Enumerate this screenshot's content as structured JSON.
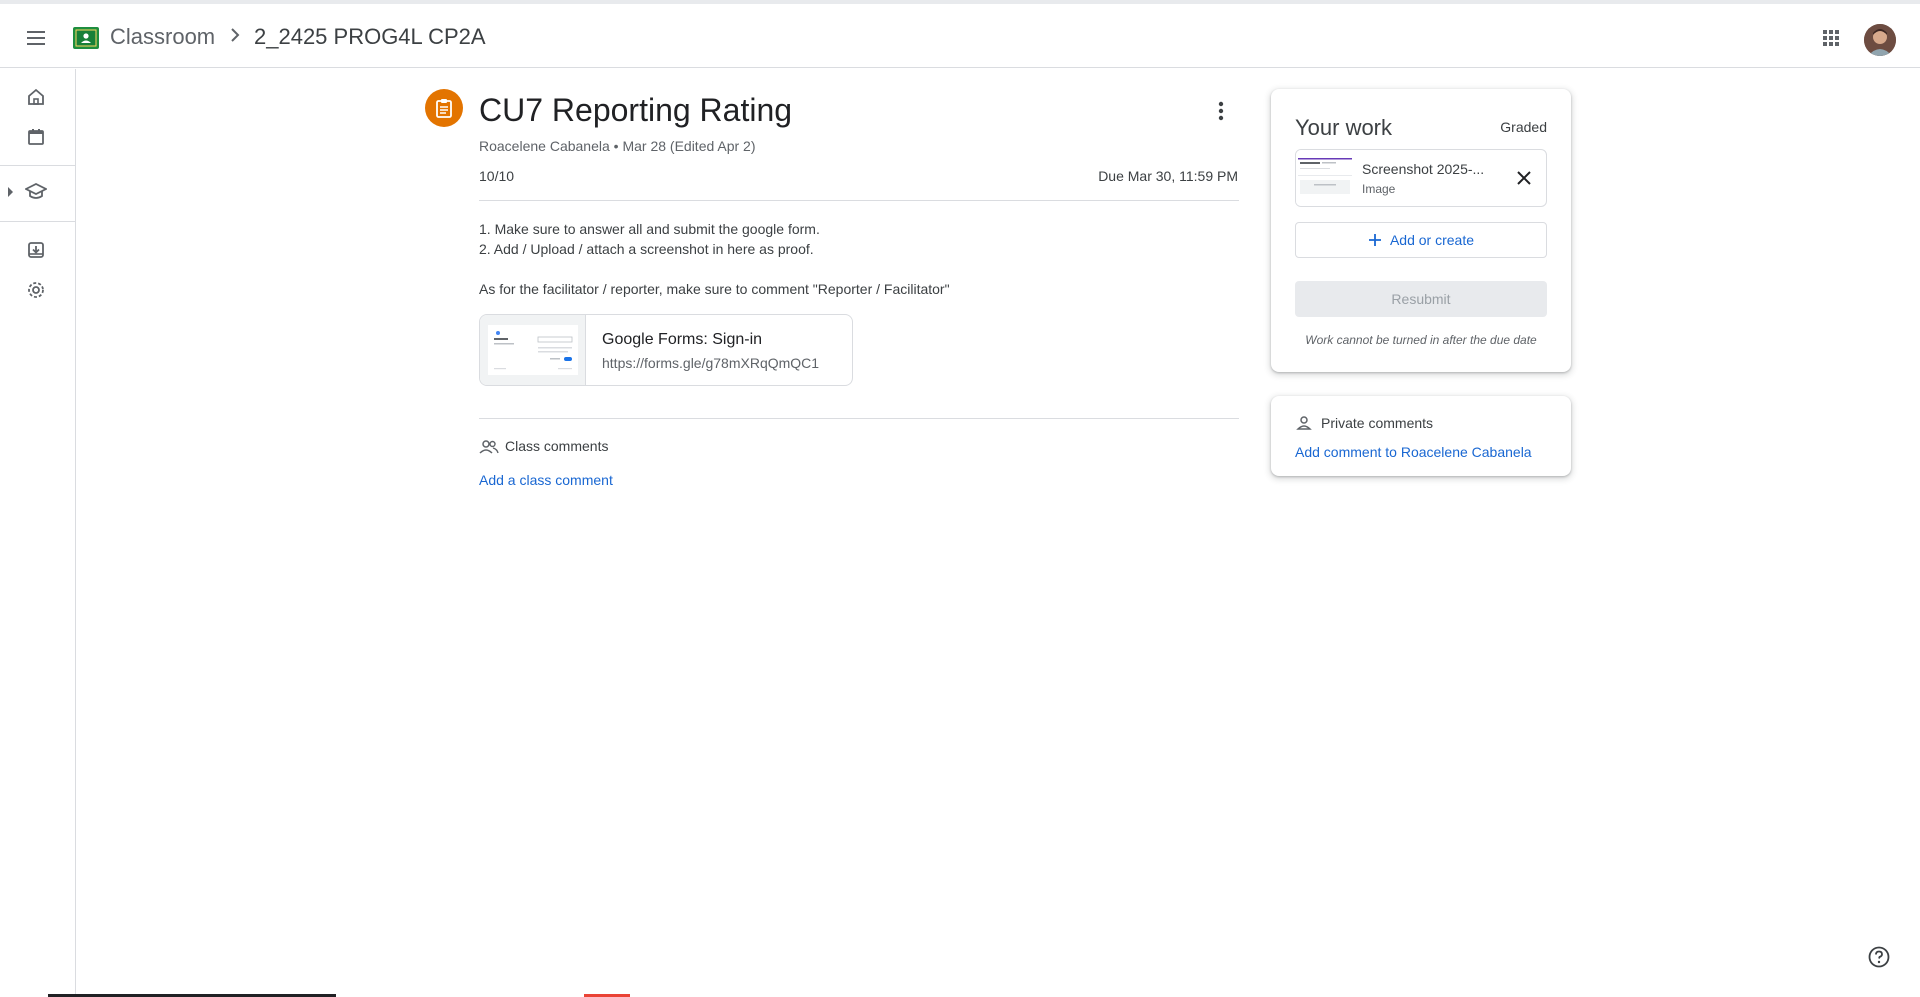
{
  "header": {
    "app_name": "Classroom",
    "course_name": "2_2425 PROG4L CP2A"
  },
  "assignment": {
    "title": "CU7 Reporting Rating",
    "meta": "Roacelene Cabanela • Mar 28 (Edited Apr 2)",
    "points": "10/10",
    "due": "Due Mar 30, 11:59 PM",
    "instructions": [
      "1. Make sure to answer all and submit the google form.",
      "2. Add / Upload / attach a screenshot in here as proof.",
      "",
      "As for the facilitator / reporter, make sure to comment \"Reporter / Facilitator\""
    ],
    "attachment": {
      "title": "Google Forms: Sign-in",
      "url": "https://forms.gle/g78mXRqQmQC1"
    }
  },
  "class_comments": {
    "label": "Class comments",
    "add_label": "Add a class comment"
  },
  "your_work": {
    "title": "Your work",
    "status": "Graded",
    "file": {
      "name": "Screenshot 2025-...",
      "type": "Image"
    },
    "add_label": "Add or create",
    "resubmit_label": "Resubmit",
    "note": "Work cannot be turned in after the due date"
  },
  "private_comments": {
    "label": "Private comments",
    "add_label": "Add comment to Roacelene Cabanela"
  },
  "colors": {
    "accent_blue": "#1967d2",
    "assignment_orange": "#e37400",
    "classroom_green": "#1e8e3e"
  }
}
